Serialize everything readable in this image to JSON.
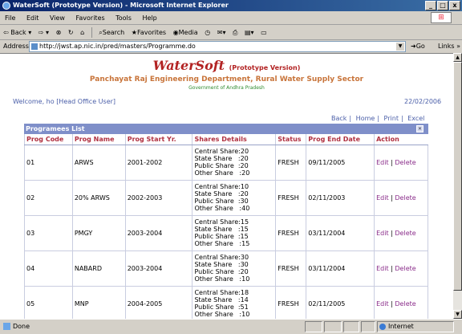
{
  "window": {
    "title": "WaterSoft (Prototype Version) - Microsoft Internet Explorer"
  },
  "menu": [
    "File",
    "Edit",
    "View",
    "Favorites",
    "Tools",
    "Help"
  ],
  "toolbar": {
    "back": "Back",
    "search": "Search",
    "favorites": "Favorites",
    "media": "Media"
  },
  "address": {
    "label": "Address",
    "url": "http://jwst.ap.nic.in/pred/masters/Programme.do",
    "go": "Go",
    "links": "Links"
  },
  "header": {
    "brand": "WaterSoft",
    "brand_suffix": "(Prototype Version)",
    "dept": "Panchayat Raj Engineering Department, Rural Water Supply Sector",
    "gov": "Government of Andhra Pradesh"
  },
  "welcome": "Welcome, ho [Head Office User]",
  "date": "22/02/2006",
  "nav": {
    "back": "Back",
    "home": "Home",
    "print": "Print",
    "excel": "Excel"
  },
  "panel": {
    "title": "Programees List"
  },
  "columns": [
    "Prog Code",
    "Prog Name",
    "Prog Start Yr.",
    "Shares Details",
    "Status",
    "Prog End Date",
    "Action"
  ],
  "rows": [
    {
      "code": "01",
      "name": "ARWS",
      "start": "2001-2002",
      "shares": "Central Share:20\nState Share   :20\nPublic Share  :20\nOther Share   :20",
      "status": "FRESH",
      "end": "09/11/2005",
      "edit": "Edit",
      "delete": "Delete"
    },
    {
      "code": "02",
      "name": "20% ARWS",
      "start": "2002-2003",
      "shares": "Central Share:10\nState Share   :20\nPublic Share  :30\nOther Share   :40",
      "status": "FRESH",
      "end": "02/11/2003",
      "edit": "Edit",
      "delete": "Delete"
    },
    {
      "code": "03",
      "name": "PMGY",
      "start": "2003-2004",
      "shares": "Central Share:15\nState Share   :15\nPublic Share  :15\nOther Share   :15",
      "status": "FRESH",
      "end": "03/11/2004",
      "edit": "Edit",
      "delete": "Delete"
    },
    {
      "code": "04",
      "name": "NABARD",
      "start": "2003-2004",
      "shares": "Central Share:30\nState Share   :30\nPublic Share  :20\nOther Share   :10",
      "status": "FRESH",
      "end": "03/11/2004",
      "edit": "Edit",
      "delete": "Delete"
    },
    {
      "code": "05",
      "name": "MNP",
      "start": "2004-2005",
      "shares": "Central Share:18\nState Share   :14\nPublic Share  :51\nOther Share   :10",
      "status": "FRESH",
      "end": "02/11/2005",
      "edit": "Edit",
      "delete": "Delete"
    }
  ],
  "status": {
    "text": "Done",
    "zone": "Internet"
  }
}
